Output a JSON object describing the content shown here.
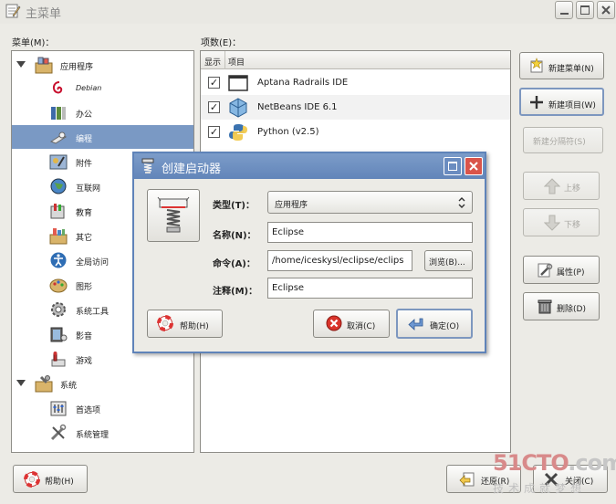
{
  "window": {
    "title": "主菜单"
  },
  "menu_label": "菜单(M)：",
  "items_label": "项数(E)：",
  "tree": [
    {
      "label": "应用程序",
      "icon": "applications-folder-icon",
      "level": 0,
      "expanded": true
    },
    {
      "label": "Debian",
      "icon": "debian-icon",
      "level": 1
    },
    {
      "label": "办公",
      "icon": "office-icon",
      "level": 1
    },
    {
      "label": "编程",
      "icon": "programming-icon",
      "level": 1,
      "selected": true
    },
    {
      "label": "附件",
      "icon": "accessories-icon",
      "level": 1
    },
    {
      "label": "互联网",
      "icon": "internet-globe-icon",
      "level": 1
    },
    {
      "label": "教育",
      "icon": "education-icon",
      "level": 1
    },
    {
      "label": "其它",
      "icon": "other-icon",
      "level": 1
    },
    {
      "label": "全局访问",
      "icon": "accessibility-icon",
      "level": 1
    },
    {
      "label": "图形",
      "icon": "graphics-icon",
      "level": 1
    },
    {
      "label": "系统工具",
      "icon": "system-tools-icon",
      "level": 1
    },
    {
      "label": "影音",
      "icon": "multimedia-icon",
      "level": 1
    },
    {
      "label": "游戏",
      "icon": "games-icon",
      "level": 1
    },
    {
      "label": "系统",
      "icon": "system-folder-icon",
      "level": 0,
      "expanded": true
    },
    {
      "label": "首选项",
      "icon": "preferences-icon",
      "level": 1
    },
    {
      "label": "系统管理",
      "icon": "administration-icon",
      "level": 1
    }
  ],
  "columns": {
    "show": "显示",
    "item": "项目"
  },
  "items": [
    {
      "label": "Aptana Radrails IDE",
      "checked": true,
      "icon": "aptana-icon"
    },
    {
      "label": "NetBeans IDE 6.1",
      "checked": true,
      "icon": "netbeans-icon"
    },
    {
      "label": "Python (v2.5)",
      "checked": true,
      "icon": "python-icon"
    }
  ],
  "buttons": {
    "new_menu": "新建菜单(N)",
    "new_item": "新建项目(W)",
    "new_separator": "新建分隔符(S)",
    "move_up": "上移",
    "move_down": "下移",
    "properties": "属性(P)",
    "delete": "删除(D)",
    "help": "帮助(H)",
    "revert": "还原(R)",
    "close": "关闭(C)"
  },
  "dialog": {
    "title": "创建启动器",
    "type_label": "类型(T)：",
    "type_value": "应用程序",
    "name_label": "名称(N)：",
    "name_value": "Eclipse",
    "command_label": "命令(A)：",
    "command_value": "/home/iceskysl/eclipse/eclips",
    "browse": "浏览(B)...",
    "comment_label": "注释(M)：",
    "comment_value": "Eclipse",
    "help": "帮助(H)",
    "cancel": "取消(C)",
    "ok": "确定(O)"
  },
  "watermark": {
    "brand_a": "51CTO",
    "brand_b": ".com",
    "tagline": "技术成就梦想"
  },
  "colors": {
    "selection": "#7a99c4",
    "dialog_title": "#6285b9",
    "window_bg": "#ecebe6"
  }
}
